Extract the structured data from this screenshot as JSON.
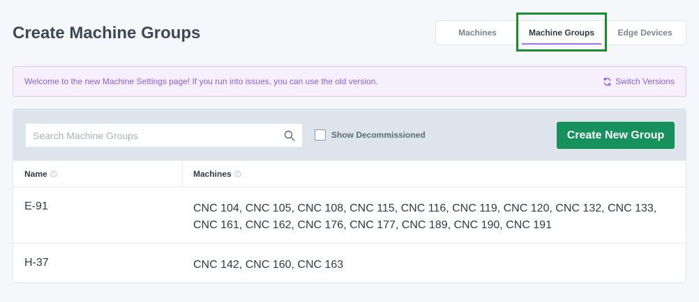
{
  "page": {
    "title": "Create Machine Groups"
  },
  "tabs": [
    {
      "label": "Machines"
    },
    {
      "label": "Machine Groups",
      "active": true
    },
    {
      "label": "Edge Devices"
    }
  ],
  "banner": {
    "message": "Welcome to the new Machine Settings page! If you run into issues, you can use the old version.",
    "switch_label": "Switch Versions"
  },
  "toolbar": {
    "search_placeholder": "Search Machine Groups",
    "show_decommissioned_label": "Show Decommissioned",
    "show_decommissioned_checked": false,
    "create_button_label": "Create New Group"
  },
  "table": {
    "columns": [
      "Name",
      "Machines"
    ],
    "rows": [
      {
        "name": "E-91",
        "machines": "CNC 104, CNC 105, CNC 108, CNC 115, CNC 116, CNC 119, CNC 120, CNC 132, CNC 133, CNC 161, CNC 162, CNC 176, CNC 177, CNC 189, CNC 190, CNC 191"
      },
      {
        "name": "H-37",
        "machines": "CNC 142, CNC 160, CNC 163"
      }
    ]
  },
  "colors": {
    "accent_green": "#16915c",
    "banner_purple": "#8b5fd6",
    "highlight": "#1a8a2e"
  }
}
